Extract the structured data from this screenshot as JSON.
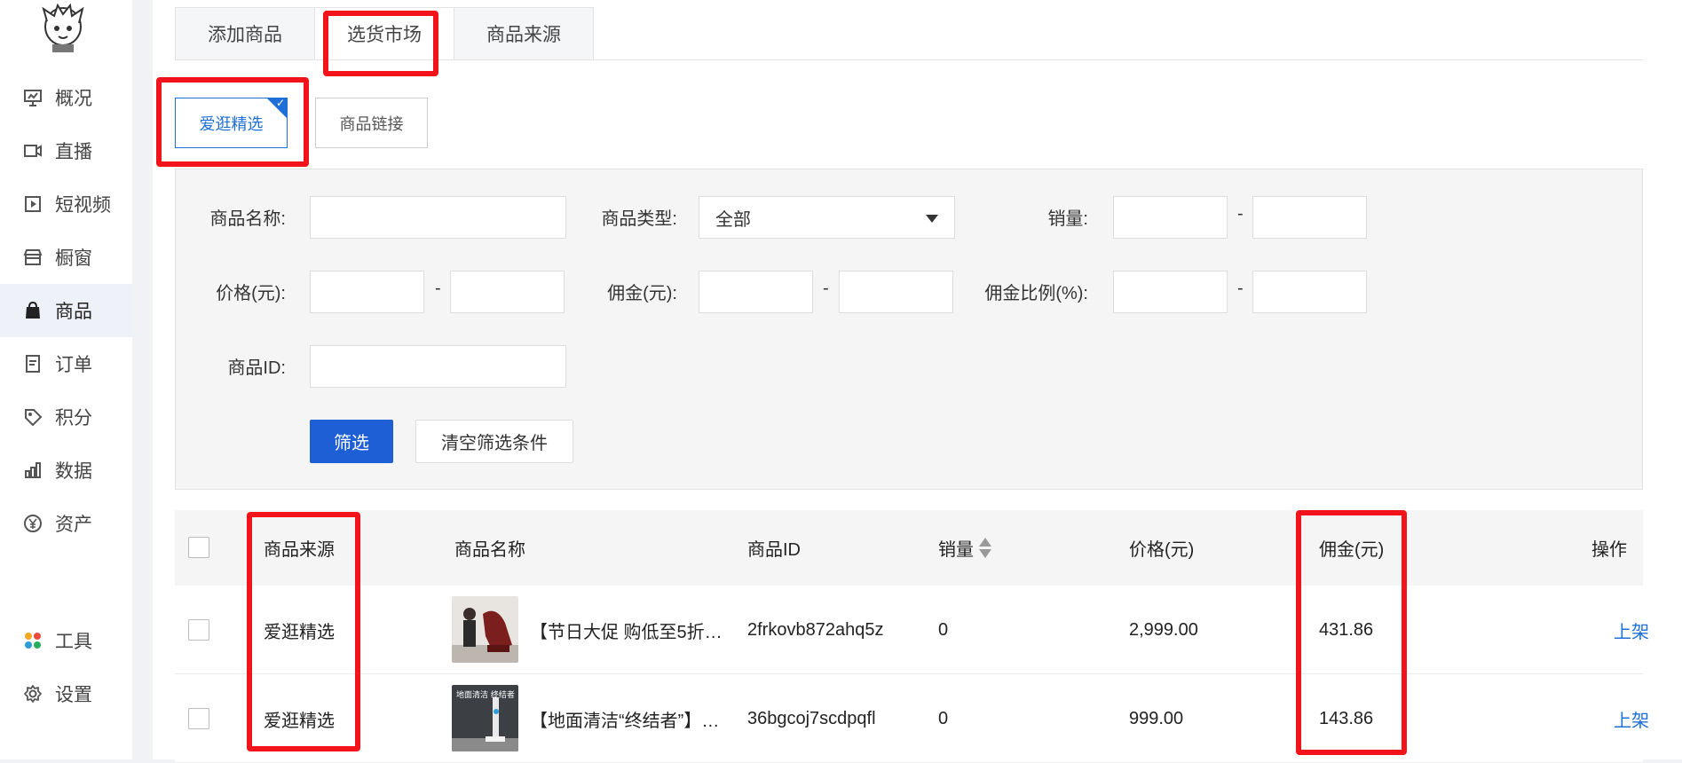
{
  "sidebar": {
    "items": [
      {
        "label": "概况",
        "icon": "presentation-icon"
      },
      {
        "label": "直播",
        "icon": "video-camera-icon"
      },
      {
        "label": "短视频",
        "icon": "play-square-icon"
      },
      {
        "label": "橱窗",
        "icon": "storefront-icon"
      },
      {
        "label": "商品",
        "icon": "shopping-bag-icon",
        "active": true
      },
      {
        "label": "订单",
        "icon": "document-icon"
      },
      {
        "label": "积分",
        "icon": "location-tag-icon"
      },
      {
        "label": "数据",
        "icon": "bar-chart-icon"
      },
      {
        "label": "资产",
        "icon": "yuan-circle-icon"
      }
    ],
    "bottom_items": [
      {
        "label": "工具",
        "icon": "color-dots-icon"
      },
      {
        "label": "设置",
        "icon": "gear-icon"
      }
    ]
  },
  "tabs": [
    "添加商品",
    "选货市场",
    "商品来源"
  ],
  "active_tab": "选货市场",
  "source_buttons": [
    "爱逛精选",
    "商品链接"
  ],
  "selected_source": "爱逛精选",
  "filters": {
    "name_label": "商品名称:",
    "type_label": "商品类型:",
    "type_value": "全部",
    "sales_label": "销量:",
    "price_label": "价格(元):",
    "commission_label": "佣金(元):",
    "ratio_label": "佣金比例(%):",
    "id_label": "商品ID:",
    "dash": "-",
    "filter_button": "筛选",
    "clear_button": "清空筛选条件"
  },
  "table": {
    "headers": {
      "source": "商品来源",
      "name": "商品名称",
      "id": "商品ID",
      "sales": "销量",
      "price": "价格(元)",
      "commission": "佣金(元)",
      "action": "操作"
    },
    "rows": [
      {
        "source": "爱逛精选",
        "name": "【节日大促 购低至5折…",
        "id": "2frkovb872ahq5z",
        "sales": "0",
        "price": "2,999.00",
        "commission": "431.86",
        "action": "上架"
      },
      {
        "source": "爱逛精选",
        "name": "【地面清洁“终结者”】…",
        "id": "36bgcoj7scdpqfl",
        "sales": "0",
        "price": "999.00",
        "commission": "143.86",
        "action": "上架",
        "thumb_text": "地面清洁 终结者"
      }
    ]
  },
  "colors": {
    "accent": "#1f6fd9",
    "primary_button": "#1f5fd6",
    "annotation_red": "#f2141a"
  }
}
